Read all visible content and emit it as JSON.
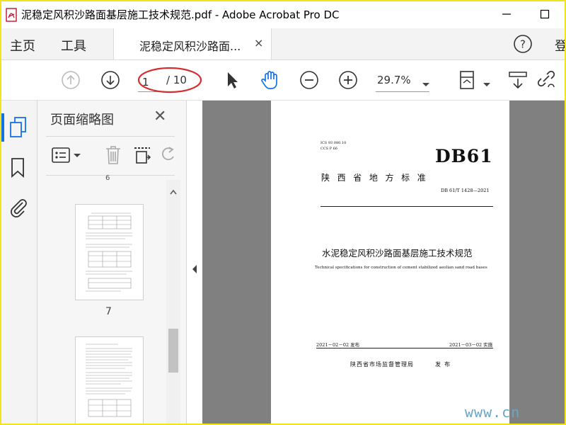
{
  "window": {
    "title": "泥稳定风积沙路面基层施工技术规范.pdf - Adobe Acrobat Pro DC",
    "app_icon": "acrobat-pdf-icon"
  },
  "menu": {
    "home": "主页",
    "tools": "工具",
    "help_icon": "help-icon",
    "overflow_text": "登"
  },
  "doc_tab": {
    "label": "泥稳定风积沙路面...",
    "close": "×"
  },
  "toolbar": {
    "page_current": "1",
    "page_total": "/ 10",
    "zoom": "29.7%",
    "annotation_color": "#d32f2f"
  },
  "panel": {
    "title": "页面缩略图",
    "close": "✕",
    "thumbnails": [
      {
        "label": "7"
      },
      {
        "label": ""
      }
    ],
    "partial_label_top": "6"
  },
  "document": {
    "ics": "ICS 93 080.10",
    "ccs": "CCS P 66",
    "standard_code": "DB61",
    "province_line": "陕  西  省  地  方  标  准",
    "number": "DB 61/T 1428—2021",
    "title_cn": "水泥稳定风积沙路面基层施工技术规范",
    "title_en": "Technical specifications for construction of cement stabilized aeolian sand road bases",
    "issue_date": "2021－02－02 发布",
    "impl_date": "2021－03－02 实施",
    "issuer": "陕西省市场监督管理局",
    "issuer_action": "发  布"
  },
  "watermark": "www.cn"
}
